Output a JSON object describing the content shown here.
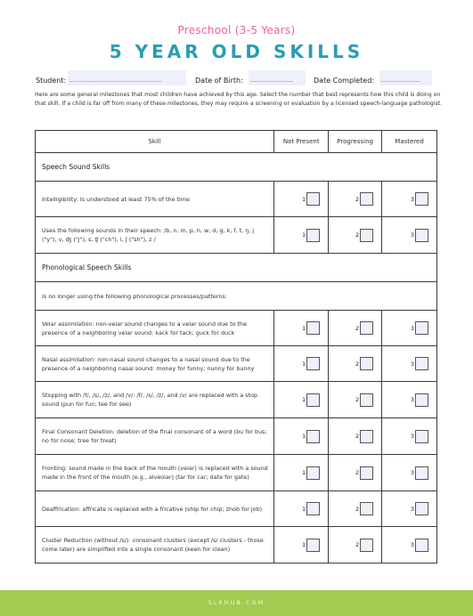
{
  "header": {
    "subtitle": "Preschool (3-5 Years)",
    "title": "5 YEAR OLD SKILLS"
  },
  "fields": {
    "student": {
      "label": "Student:",
      "value": "",
      "placeholder": "__________________________"
    },
    "dob": {
      "label": "Date of Birth:",
      "value": "",
      "placeholder": "____________"
    },
    "date_completed": {
      "label": "Date Completed:",
      "value": "",
      "placeholder": "___________"
    }
  },
  "intro": "Here are some general milestones that most children have achieved by this age.  Select the number that best represents how this child is doing on that skill.  If a child is far off from many of these milestones, they may require a screening or evaluation by a licensed speech-language pathologist.",
  "table": {
    "columns": [
      "Skill",
      "Not Present",
      "Progressing",
      "Mastered"
    ],
    "rating_numbers": [
      "1",
      "2",
      "3"
    ],
    "sections": [
      {
        "title": "Speech Sound Skills",
        "skills": [
          {
            "text": "Intelligibility: Is understood at least 75% of the time",
            "rating": null
          },
          {
            "text": "Uses the following sounds in their speech: /b, n, m, p, h, w, d, g, k, f, t, ŋ, j (\"y\"), v, ʤ (\"j\"), s, ʧ (\"ch\"), l, ʃ (\"sh\"), z /",
            "rating": null
          }
        ]
      },
      {
        "title": "Phonological Speech Skills",
        "note": "Is no longer using the following phonological processes/patterns:",
        "skills": [
          {
            "text": "Velar assimilation: non-velar sound changes to a velar sound due to the presence of a neighboring velar sound: kack for tack; guck for duck",
            "rating": null
          },
          {
            "text": "Nasal assimilation: non-nasal sound changes to a nasal sound due to the presence of a neighboring nasal sound: money for funny; nunny for bunny",
            "rating": null
          },
          {
            "text": "Stopping with /f/, /s/, /z/, and /v/: /f/, /s/, /z/, and /v/ are replaced with a stop sound (pun for fun; tee for see)",
            "rating": null
          },
          {
            "text": "Final Consonant Deletion: deletion of the final consonant of a word (bu for bus; no for nose; tree for treat)",
            "rating": null
          },
          {
            "text": "Fronting: sound made in the back of the mouth (velar) is replaced with a sound made in the front of the mouth (e.g., alveolar) (tar for car; date for gate)",
            "rating": null
          },
          {
            "text": "Deaffrication: affricate is replaced with a fricative (ship for chip; zhob for job)",
            "rating": null
          },
          {
            "text": "Cluster Reduction (without /s/): consonant clusters (except /s/ clusters - those come later) are simplified into a single consonant (keen for clean)",
            "rating": null
          }
        ]
      }
    ]
  },
  "footer": {
    "text": "SLKHUB.COM"
  },
  "colors": {
    "subtitle": "#ec5fa0",
    "title": "#2a9db3",
    "footer_band": "#a1cc4f",
    "field_fill": "#eef0fb"
  }
}
